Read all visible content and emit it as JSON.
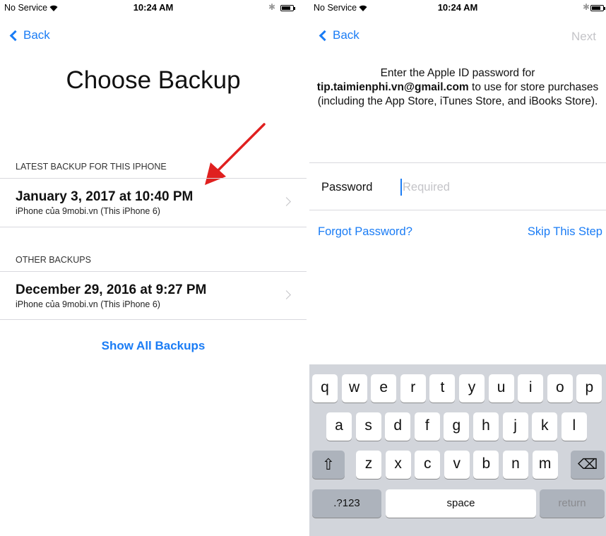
{
  "left": {
    "status": {
      "carrier": "No Service",
      "time": "10:24 AM",
      "bluetooth": "✱"
    },
    "nav": {
      "back_label": "Back"
    },
    "title": "Choose Backup",
    "latest_header": "LATEST BACKUP FOR THIS IPHONE",
    "latest": {
      "date": "January 3, 2017 at 10:40 PM",
      "device": "iPhone của 9mobi.vn (This iPhone 6)"
    },
    "other_header": "OTHER BACKUPS",
    "other": {
      "date": "December 29, 2016 at 9:27 PM",
      "device": "iPhone của 9mobi.vn (This iPhone 6)"
    },
    "show_all": "Show All Backups"
  },
  "right": {
    "status": {
      "carrier": "No Service",
      "time": "10:24 AM",
      "bluetooth": "✱"
    },
    "nav": {
      "back_label": "Back",
      "next_label": "Next"
    },
    "intro": {
      "prefix": "Enter the Apple ID password for",
      "email": "tip.taimienphi.vn@gmail.com",
      "suffix": " to use for store purchases (including the App Store, iTunes Store, and iBooks Store)."
    },
    "password": {
      "label": "Password",
      "placeholder": "Required"
    },
    "forgot": "Forgot Password?",
    "skip": "Skip This Step",
    "keyboard": {
      "row1": [
        "q",
        "w",
        "e",
        "r",
        "t",
        "y",
        "u",
        "i",
        "o",
        "p"
      ],
      "row2": [
        "a",
        "s",
        "d",
        "f",
        "g",
        "h",
        "j",
        "k",
        "l"
      ],
      "row3": [
        "z",
        "x",
        "c",
        "v",
        "b",
        "n",
        "m"
      ],
      "shift_symbol": "⇧",
      "delete_symbol": "⌫",
      "numbers_label": ".?123",
      "space_label": "space",
      "return_label": "return"
    }
  },
  "colors": {
    "accent": "#1a7cf5",
    "arrow": "#e0201f",
    "keyboard_bg": "#d2d5db"
  }
}
